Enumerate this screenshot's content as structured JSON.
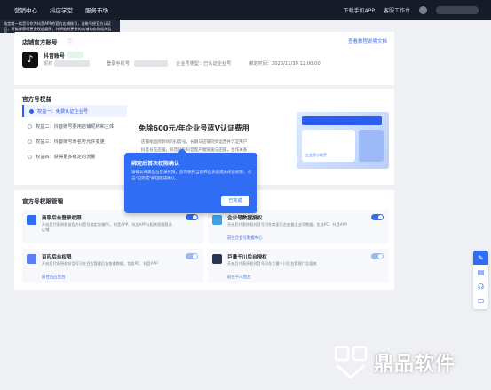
{
  "topnav": {
    "items": [
      "营销中心",
      "抖店学堂",
      "服务市场"
    ],
    "download_app": "下载手机APP",
    "service": "客服工作台"
  },
  "tooltip": {
    "text": "选定唯一抖音号作为抖音APP的官方店铺账号，该账号经官方认证后，将能够获得更多权益展示，并将收到更多的店铺动态和相关信息。"
  },
  "account": {
    "title": "店铺官方账号",
    "doc_link": "查看教程说明文档",
    "name": "抖音账号",
    "nick_label": "昵称",
    "phone_label": "登录手机号",
    "enterprise": "企业号类型：已认证企业号",
    "bind_time": "绑定时间：2020/11/30 12:00:00"
  },
  "rights": {
    "title": "官方号权益",
    "items": [
      "权益一：免费认证企业号",
      "权益二：抖音账号要用店铺昵称和主体",
      "权益三：抖音账号命名可允许变更",
      "权益四：获得更多稳定的流量"
    ],
    "headline": "免除600元/年企业号蓝V认证费用",
    "bullets": [
      "· 店铺缩品牌影响的抖音号，长期与店铺同步运营并沉淀用户",
      "· 抖音号在店铺，抖音号在抖音客户端快速与店铺，合作关系"
    ],
    "promo_caption": "企业号小助手"
  },
  "popup": {
    "title": "绑定后首次权限确认",
    "body": "请确认商家后台登录权限，您可保持当前开启状态或关闭该权限，点击\"已完成\"按钮完成确认。",
    "button": "已完成"
  },
  "mgmt": {
    "title": "官方号权限管理",
    "perms": [
      {
        "title": "商家后台登录权限",
        "desc": "开启后代表授权该官方抖音号绑定店铺PC、抖音APP、抖店APP以相关权限登录店铺",
        "link": ""
      },
      {
        "title": "企业号数据授权",
        "desc": "开启后代表授权抖音号可在商家后台查看企业号数据，包含PC、抖音APP",
        "link": "前往企业号数据中心"
      },
      {
        "title": "百应后台权限",
        "desc": "开启后代表授权抖音号可在百应管理后台查看数据，包含PC、抖音APP",
        "link": "前往百应后台"
      },
      {
        "title": "巨量千川后台授权",
        "desc": "开启后代表授权抖音号可在巨量千川后台管理广告投放",
        "link": "前往千川后台"
      }
    ]
  },
  "watermark": {
    "text": "鼎品软件"
  },
  "colors": {
    "accent": "#2f6df5",
    "nav_bg": "#161b2a"
  }
}
